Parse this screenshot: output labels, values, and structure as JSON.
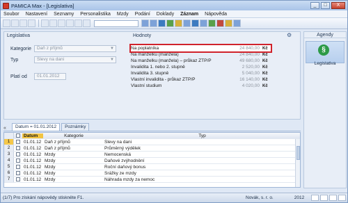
{
  "window": {
    "title": "PAMICA Max - [Legislativa]",
    "buttons": {
      "minimize": "_",
      "maximize": "□",
      "close": "X"
    }
  },
  "menu": [
    "Soubor",
    "Nastavení",
    "Seznamy",
    "Personalistika",
    "Mzdy",
    "Podání",
    "Doklady",
    "Záznam",
    "Nápověda"
  ],
  "form": {
    "section_left": "Legislativa",
    "section_right": "Hodnoty",
    "kategorie_label": "Kategorie",
    "kategorie_value": "Daň z příjmů",
    "typ_label": "Typ",
    "typ_value": "Slevy na dani",
    "platiod_label": "Platí od",
    "platiod_value": "01.01.2012"
  },
  "values": [
    {
      "label": "Na poplatníka",
      "value": "24 840,00",
      "unit": "Kč",
      "highlight": true
    },
    {
      "label": "Na manželku (manžela)",
      "value": "24 840,00",
      "unit": "Kč"
    },
    {
      "label": "Na manželku (manžela) – průkaz ZTP/P",
      "value": "49 680,00",
      "unit": "Kč"
    },
    {
      "label": "Invalidita 1. nebo 2. stupně",
      "value": "2 520,00",
      "unit": "Kč"
    },
    {
      "label": "Invalidita 3. stupně",
      "value": "5 040,00",
      "unit": "Kč"
    },
    {
      "label": "Vlastní invalidita - průkaz ZTP/P",
      "value": "16 140,00",
      "unit": "Kč"
    },
    {
      "label": "Vlastní studium",
      "value": "4 020,00",
      "unit": "Kč"
    }
  ],
  "agendy": {
    "header": "Agendy",
    "item_label": "Legislativa",
    "icon_glyph": "§"
  },
  "tabs": [
    {
      "label": "Datum = 01.01.2012",
      "active": true
    },
    {
      "label": "Poznámky",
      "active": false
    }
  ],
  "grid": {
    "headers": {
      "datum": "Datum",
      "kategorie": "Kategorie",
      "typ": "Typ"
    },
    "rows": [
      {
        "num": "1",
        "datum": "01.01.12",
        "kategorie": "Daň z příjmů",
        "typ": "Slevy na dani"
      },
      {
        "num": "2",
        "datum": "01.01.12",
        "kategorie": "Daň z příjmů",
        "typ": "Průměrný výdělek"
      },
      {
        "num": "3",
        "datum": "01.01.12",
        "kategorie": "Mzdy",
        "typ": "Nemocenská"
      },
      {
        "num": "4",
        "datum": "01.01.12",
        "kategorie": "Mzdy",
        "typ": "Daňové zvýhodnění"
      },
      {
        "num": "5",
        "datum": "01.01.12",
        "kategorie": "Mzdy",
        "typ": "Roční daňový bonus"
      },
      {
        "num": "6",
        "datum": "01.01.12",
        "kategorie": "Mzdy",
        "typ": "Srážky ze mzdy"
      },
      {
        "num": "7",
        "datum": "01.01.12",
        "kategorie": "Mzdy",
        "typ": "Náhrada mzdy za nemoc"
      }
    ]
  },
  "status": {
    "help": "(1/7) Pro získání nápovědy stiskněte F1.",
    "company": "Novák, s. r. o.",
    "year": "2012"
  },
  "colors": {
    "highlight": "#d0222b",
    "date_header": "#f2c440",
    "agendy_icon": "#2d9a47"
  }
}
